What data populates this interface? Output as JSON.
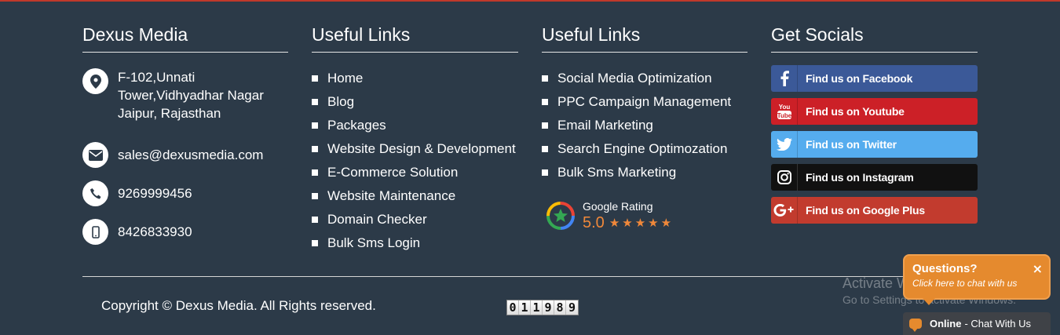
{
  "colors": {
    "background": "#2c3a48",
    "accent_orange": "#e58a2e",
    "facebook": "#3b5998",
    "youtube": "#cc2027",
    "twitter": "#55acee",
    "instagram": "#111111",
    "googleplus": "#c23b2e"
  },
  "company": {
    "title": "Dexus Media",
    "address_line1": "F-102,Unnati",
    "address_line2": "Tower,Vidhyadhar Nagar",
    "address_line3": "Jaipur, Rajasthan",
    "email": "sales@dexusmedia.com",
    "phone": "9269999456",
    "mobile": "8426833930",
    "icons": [
      "map-pin-icon",
      "envelope-icon",
      "phone-icon",
      "mobile-icon"
    ]
  },
  "links1": {
    "title": "Useful Links",
    "items": [
      "Home",
      "Blog",
      "Packages",
      "Website Design & Development",
      "E-Commerce Solution",
      "Website Maintenance",
      "Domain Checker",
      "Bulk Sms Login"
    ]
  },
  "links2": {
    "title": "Useful Links",
    "items": [
      "Social Media Optimization",
      "PPC Campaign Management",
      "Email Marketing",
      "Search Engine Optimozation",
      "Bulk Sms Marketing"
    ]
  },
  "rating": {
    "label": "Google Rating",
    "value": "5.0",
    "stars": 5,
    "icon": "google-rating-icon"
  },
  "socials": {
    "title": "Get Socials",
    "buttons": [
      {
        "label": "Find us on Facebook",
        "icon": "facebook-icon"
      },
      {
        "label": "Find us on Youtube",
        "icon": "youtube-icon"
      },
      {
        "label": "Find us on Twitter",
        "icon": "twitter-icon"
      },
      {
        "label": "Find us on Instagram",
        "icon": "instagram-icon"
      },
      {
        "label": "Find us on Google Plus",
        "icon": "google-plus-icon"
      }
    ]
  },
  "footer": {
    "copyright": "Copyright © Dexus Media. All Rights reserved.",
    "counter_digits": [
      "0",
      "1",
      "1",
      "9",
      "8",
      "9"
    ]
  },
  "watermark": {
    "line1": "Activate Windows",
    "line2": "Go to Settings to activate Windows."
  },
  "chat": {
    "question": "Questions?",
    "subtitle": "Click here to chat with us",
    "close": "×",
    "status": "Online",
    "status_text": "- Chat With Us"
  }
}
